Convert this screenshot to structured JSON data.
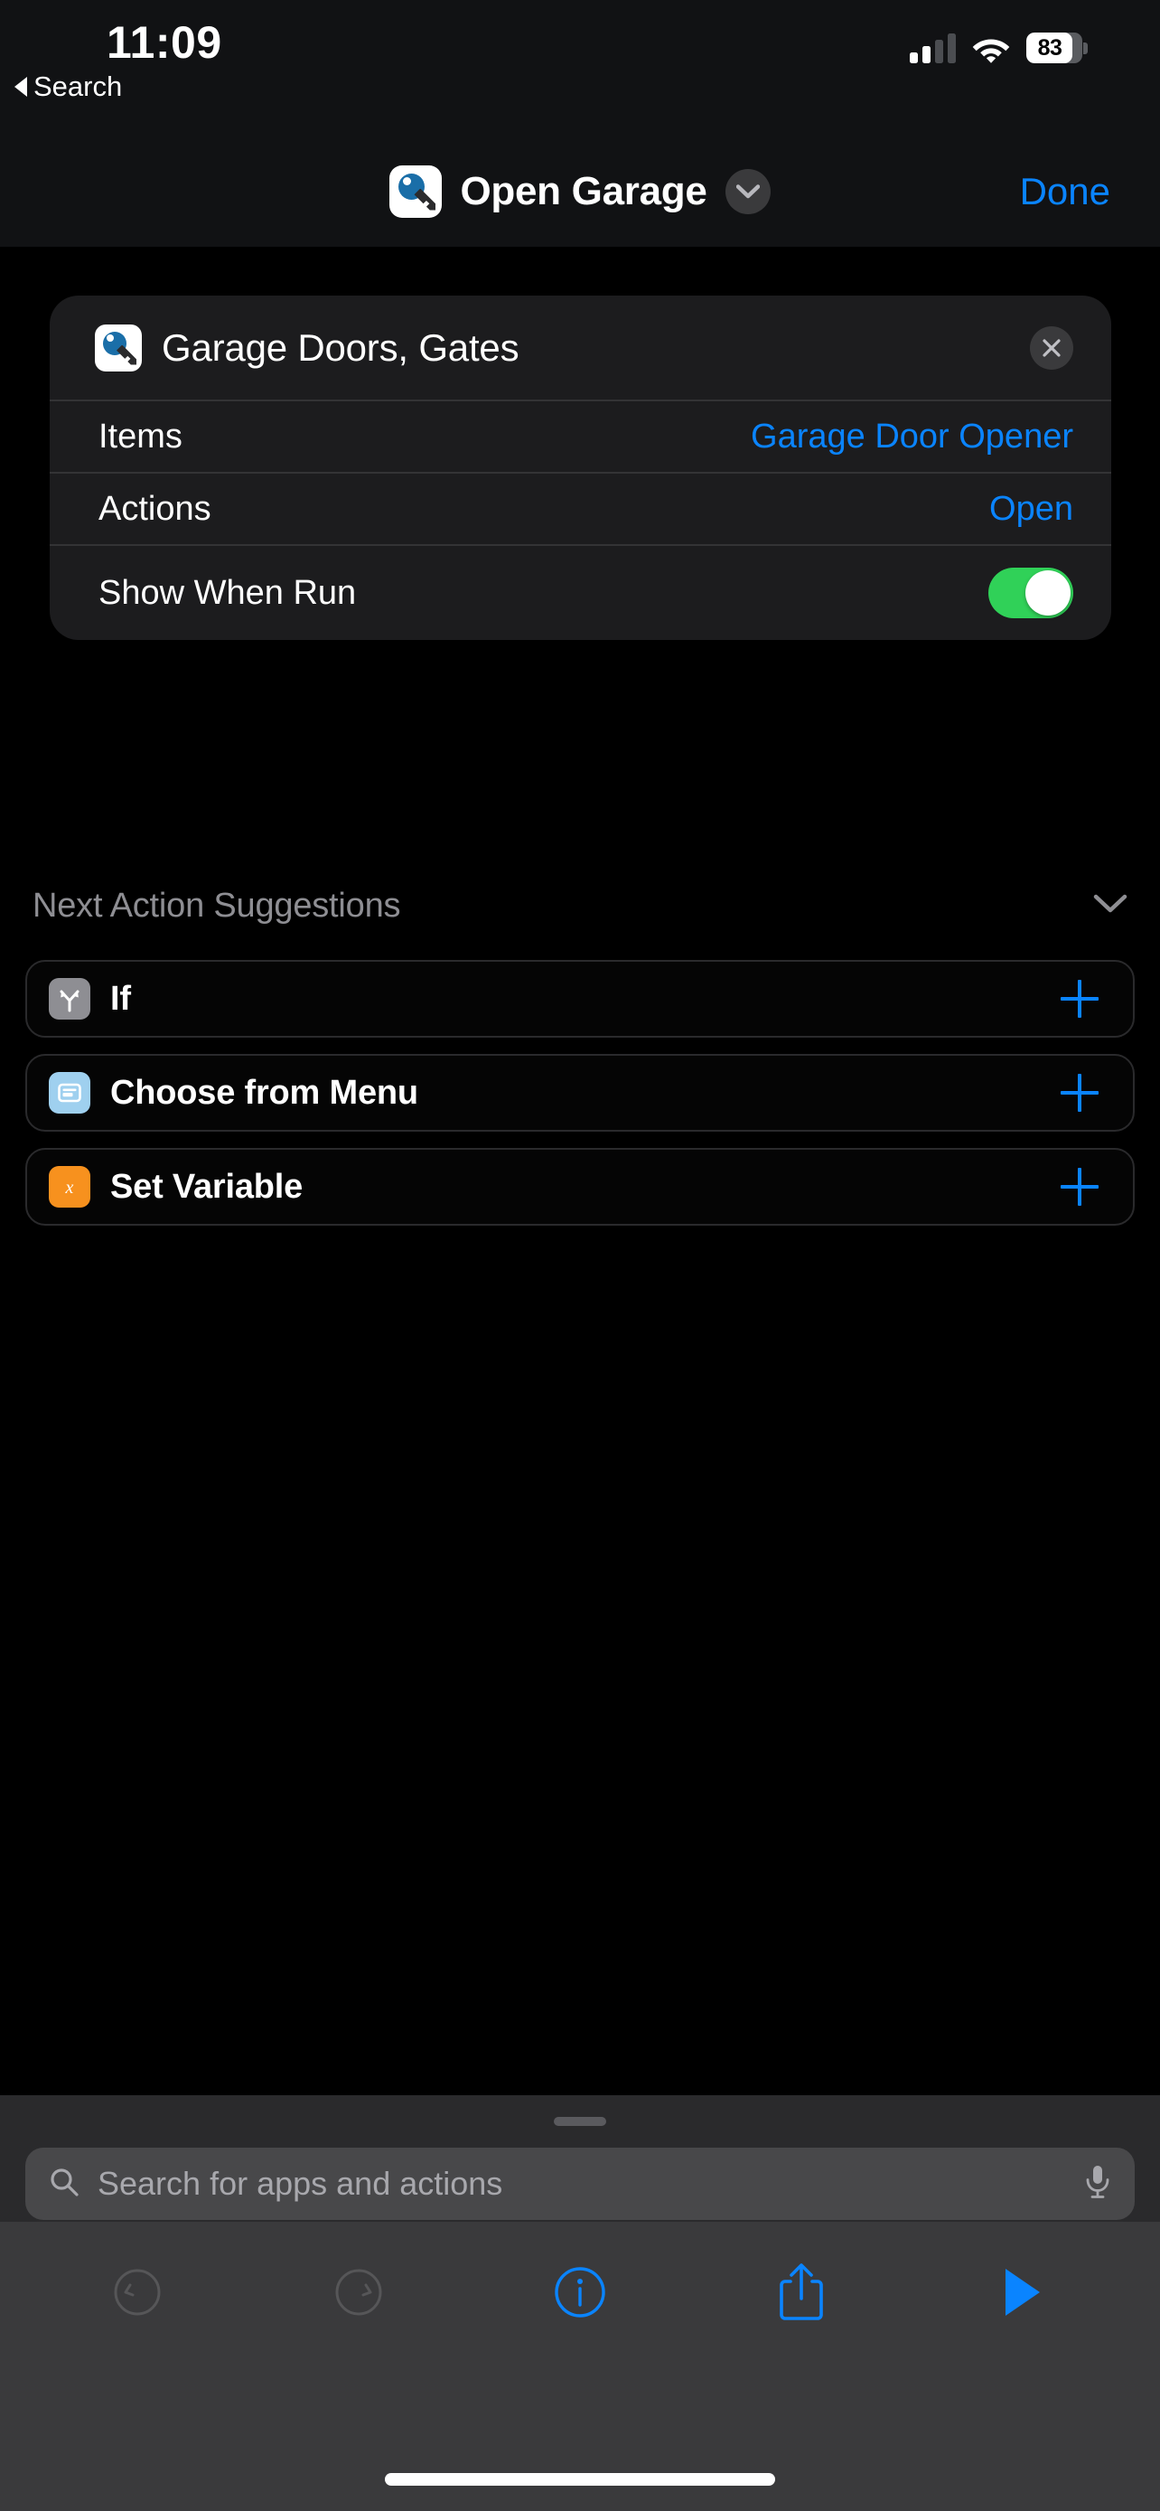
{
  "status_bar": {
    "time": "11:09",
    "battery_percent": "83",
    "signal_bars_filled": 2,
    "signal_bars_total": 4,
    "wifi_icon": "wifi-icon",
    "battery_icon": "battery-icon"
  },
  "back_link": {
    "label": "Search",
    "icon": "back-triangle-icon"
  },
  "nav_bar": {
    "title": "Open Garage",
    "app_icon": "key-icon",
    "chevron_icon": "chevron-down-icon",
    "done_label": "Done"
  },
  "action_card": {
    "title": "Garage Doors, Gates",
    "icon": "key-icon",
    "close_icon": "close-x-icon",
    "rows": [
      {
        "label": "Items",
        "value": "Garage Door Opener",
        "type": "value"
      },
      {
        "label": "Actions",
        "value": "Open",
        "type": "value"
      },
      {
        "label": "Show When Run",
        "value": "on",
        "type": "toggle"
      }
    ]
  },
  "suggestions": {
    "header": "Next Action Suggestions",
    "collapse_icon": "chevron-down-icon",
    "items": [
      {
        "label": "If",
        "icon": "branch-icon",
        "icon_color": "#8e8e93",
        "add_icon": "plus-icon"
      },
      {
        "label": "Choose from Menu",
        "icon": "menu-list-icon",
        "icon_color": "#9fd0ef",
        "add_icon": "plus-icon"
      },
      {
        "label": "Set Variable",
        "icon": "variable-x-icon",
        "icon_color": "#f7911e",
        "add_icon": "plus-icon"
      }
    ]
  },
  "search": {
    "placeholder": "Search for apps and actions",
    "search_icon": "search-icon",
    "mic_icon": "microphone-icon",
    "grabber": "drag-handle"
  },
  "toolbar": {
    "buttons": [
      {
        "name": "undo-button",
        "icon": "undo-arrow-icon",
        "enabled": false
      },
      {
        "name": "redo-button",
        "icon": "redo-arrow-icon",
        "enabled": false
      },
      {
        "name": "info-button",
        "icon": "info-circle-icon",
        "enabled": true
      },
      {
        "name": "share-button",
        "icon": "share-icon",
        "enabled": true
      },
      {
        "name": "run-button",
        "icon": "play-icon",
        "enabled": true
      }
    ]
  },
  "colors": {
    "accent_blue": "#0a84ff",
    "toggle_green": "#30d158",
    "background": "#000000",
    "card_background": "#1c1c1e",
    "secondary_text": "#8e8e93"
  }
}
